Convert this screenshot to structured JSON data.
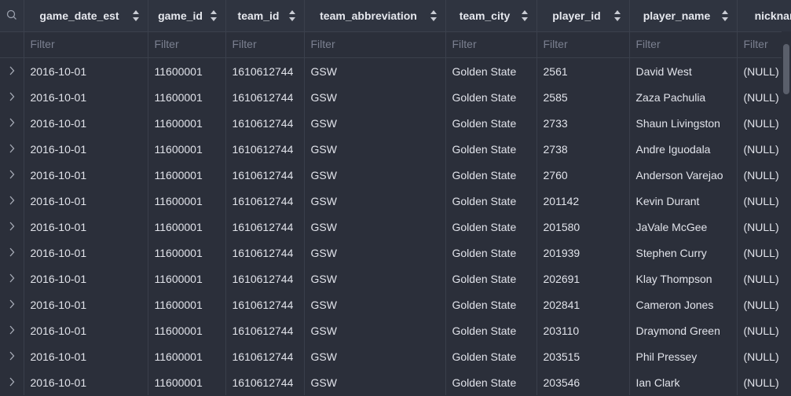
{
  "columns": [
    {
      "label": "game_date_est"
    },
    {
      "label": "game_id"
    },
    {
      "label": "team_id"
    },
    {
      "label": "team_abbreviation"
    },
    {
      "label": "team_city"
    },
    {
      "label": "player_id"
    },
    {
      "label": "player_name"
    },
    {
      "label": "nicknam"
    }
  ],
  "filter_placeholder": "Filter",
  "rows": [
    [
      "2016-10-01",
      "11600001",
      "1610612744",
      "GSW",
      "Golden State",
      "2561",
      "David West",
      "(NULL)"
    ],
    [
      "2016-10-01",
      "11600001",
      "1610612744",
      "GSW",
      "Golden State",
      "2585",
      "Zaza Pachulia",
      "(NULL)"
    ],
    [
      "2016-10-01",
      "11600001",
      "1610612744",
      "GSW",
      "Golden State",
      "2733",
      "Shaun Livingston",
      "(NULL)"
    ],
    [
      "2016-10-01",
      "11600001",
      "1610612744",
      "GSW",
      "Golden State",
      "2738",
      "Andre Iguodala",
      "(NULL)"
    ],
    [
      "2016-10-01",
      "11600001",
      "1610612744",
      "GSW",
      "Golden State",
      "2760",
      "Anderson Varejao",
      "(NULL)"
    ],
    [
      "2016-10-01",
      "11600001",
      "1610612744",
      "GSW",
      "Golden State",
      "201142",
      "Kevin Durant",
      "(NULL)"
    ],
    [
      "2016-10-01",
      "11600001",
      "1610612744",
      "GSW",
      "Golden State",
      "201580",
      "JaVale McGee",
      "(NULL)"
    ],
    [
      "2016-10-01",
      "11600001",
      "1610612744",
      "GSW",
      "Golden State",
      "201939",
      "Stephen Curry",
      "(NULL)"
    ],
    [
      "2016-10-01",
      "11600001",
      "1610612744",
      "GSW",
      "Golden State",
      "202691",
      "Klay Thompson",
      "(NULL)"
    ],
    [
      "2016-10-01",
      "11600001",
      "1610612744",
      "GSW",
      "Golden State",
      "202841",
      "Cameron Jones",
      "(NULL)"
    ],
    [
      "2016-10-01",
      "11600001",
      "1610612744",
      "GSW",
      "Golden State",
      "203110",
      "Draymond Green",
      "(NULL)"
    ],
    [
      "2016-10-01",
      "11600001",
      "1610612744",
      "GSW",
      "Golden State",
      "203515",
      "Phil Pressey",
      "(NULL)"
    ],
    [
      "2016-10-01",
      "11600001",
      "1610612744",
      "GSW",
      "Golden State",
      "203546",
      "Ian Clark",
      "(NULL)"
    ]
  ],
  "icons": {
    "search": "search-icon",
    "expand": "chevron-right-icon",
    "sort": "sort-icon"
  },
  "colors": {
    "background": "#2b2f3a",
    "header": "#2f3440",
    "text": "#e1e3ea",
    "muted": "#7b8090"
  }
}
